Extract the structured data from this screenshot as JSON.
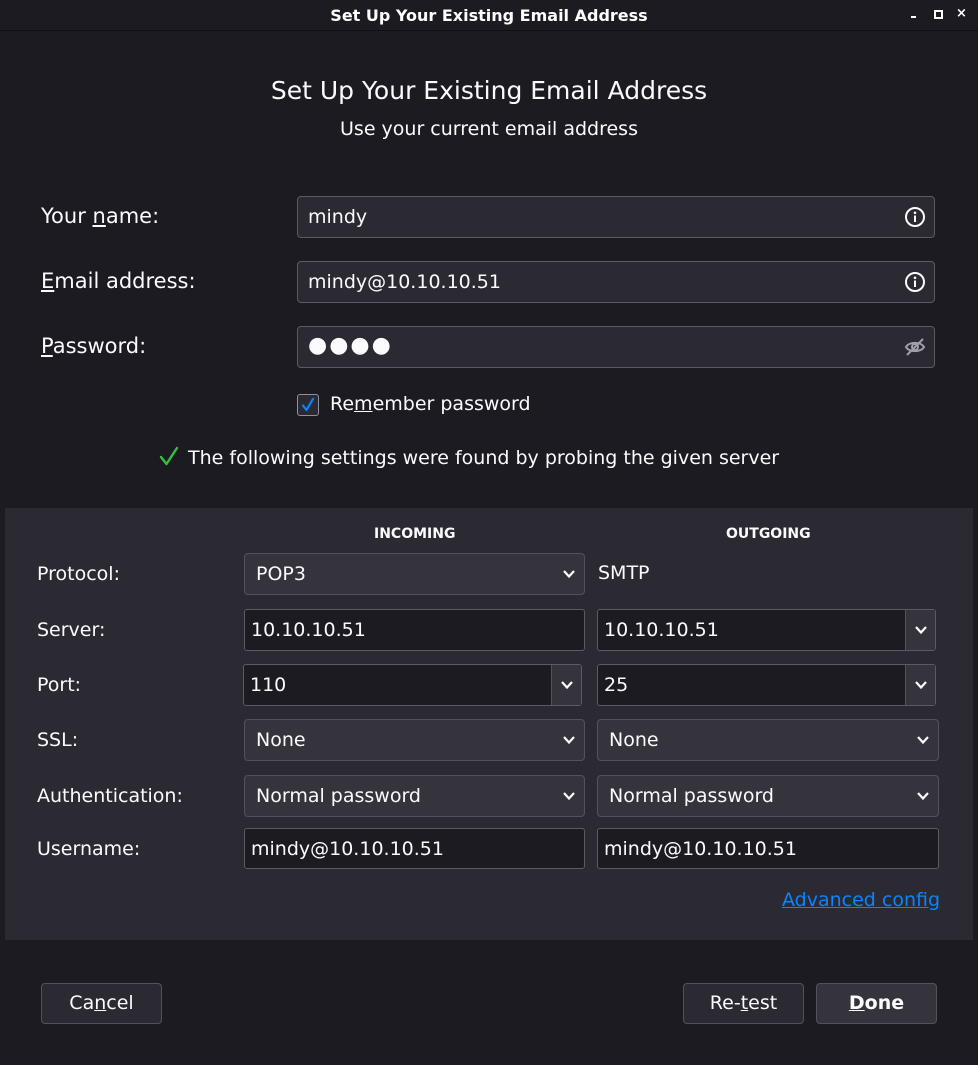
{
  "window": {
    "title": "Set Up Your Existing Email Address",
    "controls": [
      "minimize-icon",
      "maximize-icon",
      "close-icon"
    ],
    "close_glyph": "×"
  },
  "header": {
    "title": "Set Up Your Existing Email Address",
    "subtitle": "Use your current email address"
  },
  "form": {
    "name": {
      "label_pre": "Your ",
      "label_u": "n",
      "label_post": "ame:",
      "value": "mindy",
      "icon": "info-icon"
    },
    "email": {
      "label_pre": "",
      "label_u": "E",
      "label_post": "mail address:",
      "value": "mindy@10.10.10.51",
      "icon": "info-icon"
    },
    "password": {
      "label_pre": "",
      "label_u": "P",
      "label_post": "assword:",
      "value": "●●●●",
      "icon": "eye-slash-icon"
    },
    "remember": {
      "label_pre": "Re",
      "label_u": "m",
      "label_post": "ember password",
      "checked": true
    }
  },
  "status": {
    "text": "The following settings were found by probing the given server",
    "icon": "checkmark-icon",
    "color": "#3fe1b0"
  },
  "settings": {
    "incoming_header": "INCOMING",
    "outgoing_header": "OUTGOING",
    "labels": {
      "protocol": "Protocol:",
      "server": "Server:",
      "port": "Port:",
      "ssl": "SSL:",
      "auth": "Authentication:",
      "username": "Username:"
    },
    "incoming": {
      "protocol": "POP3",
      "server": "10.10.10.51",
      "port": "110",
      "ssl": "None",
      "auth": "Normal password",
      "username": "mindy@10.10.10.51"
    },
    "outgoing": {
      "protocol": "SMTP",
      "server": "10.10.10.51",
      "port": "25",
      "ssl": "None",
      "auth": "Normal password",
      "username": "mindy@10.10.10.51"
    },
    "advanced_link": "Advanced config"
  },
  "buttons": {
    "cancel": {
      "pre": "Ca",
      "u": "n",
      "post": "cel"
    },
    "retest": {
      "pre": "Re-",
      "u": "t",
      "post": "est"
    },
    "done": {
      "pre": "",
      "u": "D",
      "post": "one"
    }
  },
  "colors": {
    "accent": "#0a84ff",
    "background": "#1c1b22",
    "panel": "#2b2a33"
  }
}
